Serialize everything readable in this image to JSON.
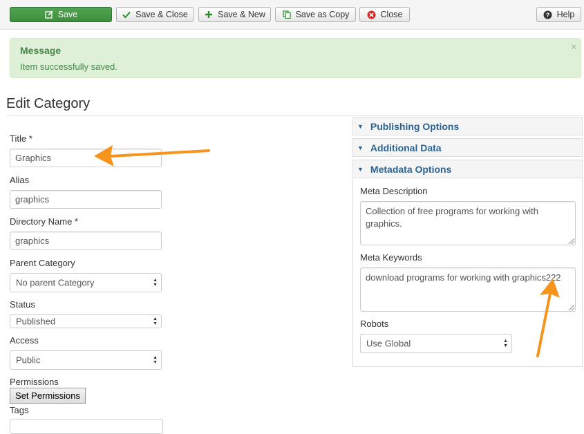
{
  "toolbar": {
    "save": "Save",
    "save_close": "Save & Close",
    "save_new": "Save & New",
    "save_copy": "Save as Copy",
    "close": "Close",
    "help": "Help"
  },
  "message": {
    "heading": "Message",
    "text": "Item successfully saved.",
    "close_glyph": "×"
  },
  "page_title": "Edit Category",
  "form": {
    "title_label": "Title *",
    "title_value": "Graphics",
    "alias_label": "Alias",
    "alias_value": "graphics",
    "dir_label": "Directory Name *",
    "dir_value": "graphics",
    "parent_label": "Parent Category",
    "parent_value": "No parent Category",
    "status_label": "Status",
    "status_value": "Published",
    "access_label": "Access",
    "access_value": "Public",
    "permissions_label": "Permissions",
    "permissions_button": "Set Permissions",
    "tags_label": "Tags"
  },
  "sidebar": {
    "publishing": "Publishing Options",
    "additional": "Additional Data",
    "metadata": "Metadata Options",
    "meta_desc_label": "Meta Description",
    "meta_desc_value": "Collection of free programs for working with graphics.",
    "meta_keywords_label": "Meta Keywords",
    "meta_keywords_value": "download programs for working with graphics222",
    "robots_label": "Robots",
    "robots_value": "Use Global"
  },
  "colors": {
    "save_green": "#51a351",
    "alert_bg": "#dff0d8",
    "alert_text": "#468847",
    "link_blue": "#2a6496",
    "annotation_orange": "#f7941d",
    "close_red": "#c9302c"
  },
  "icons": {
    "save": "edit-icon",
    "save_close": "check-icon",
    "save_new": "plus-icon",
    "save_copy": "copy-icon",
    "close": "cancel-icon",
    "help": "question-icon"
  }
}
